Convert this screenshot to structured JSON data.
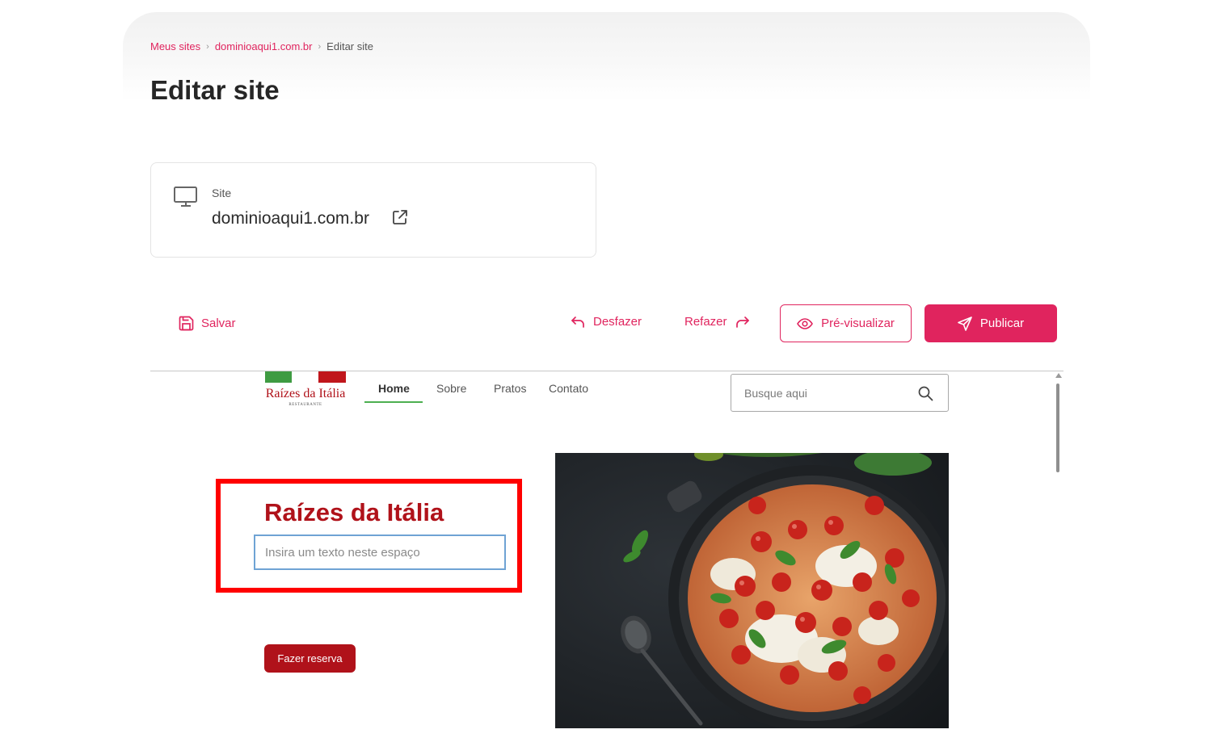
{
  "breadcrumb": {
    "items": [
      "Meus sites",
      "dominioaqui1.com.br"
    ],
    "current": "Editar site"
  },
  "page_title": "Editar site",
  "site_card": {
    "label": "Site",
    "domain": "dominioaqui1.com.br",
    "icons": [
      "monitor-icon",
      "external-link-icon"
    ]
  },
  "toolbar": {
    "save_label": "Salvar",
    "undo_label": "Desfazer",
    "redo_label": "Refazer",
    "preview_label": "Pré-visualizar",
    "publish_label": "Publicar"
  },
  "colors": {
    "accent": "#e0245e",
    "brand_red": "#b0121a",
    "brand_green": "#3f9b42",
    "highlight": "#ff0000"
  },
  "editor_site": {
    "logo": {
      "name": "Raízes da Itália",
      "subtitle": "RESTAURANTE"
    },
    "nav": {
      "items": [
        "Home",
        "Sobre",
        "Pratos",
        "Contato"
      ],
      "active": "Home"
    },
    "search": {
      "placeholder": "Busque aqui"
    },
    "hero": {
      "title": "Raízes da Itália",
      "text_placeholder": "Insira um texto neste espaço",
      "button_label": "Fazer reserva"
    }
  }
}
